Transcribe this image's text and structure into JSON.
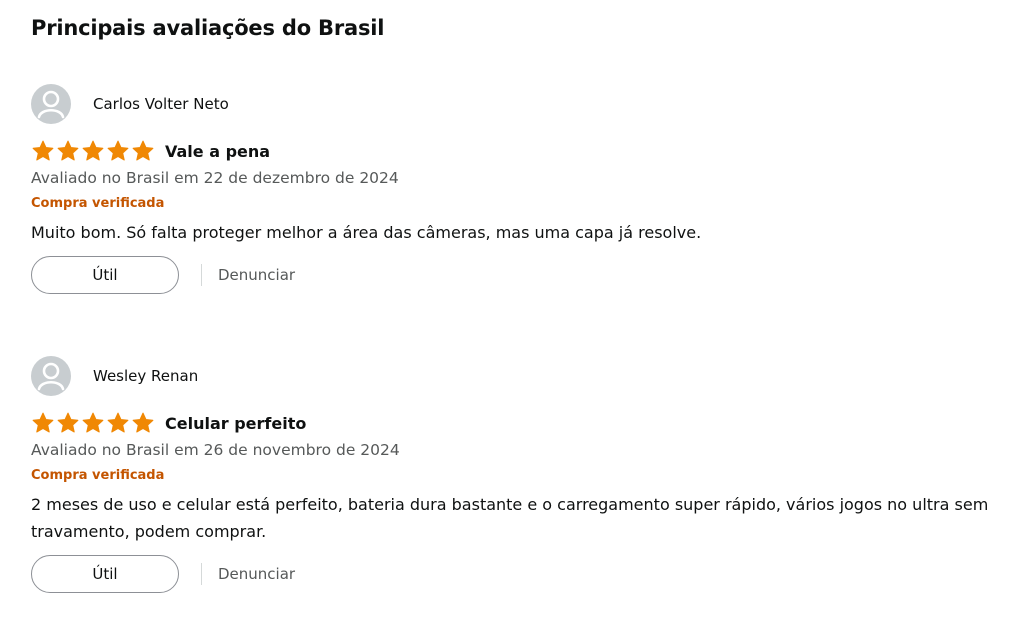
{
  "section": {
    "title": "Principais avaliações do Brasil"
  },
  "colors": {
    "star": "#f08804",
    "verified": "#c45500",
    "muted": "#565959",
    "text": "#0f1111"
  },
  "reviews": [
    {
      "author": "Carlos Volter Neto",
      "rating": 5,
      "rating_max": 5,
      "title": "Vale a pena",
      "date_text": "Avaliado no Brasil em 22 de dezembro de 2024",
      "verified_label": "Compra verificada",
      "body": "Muito bom. Só falta proteger melhor a área das câmeras, mas uma capa já resolve.",
      "helpful_label": "Útil",
      "report_label": "Denunciar"
    },
    {
      "author": "Wesley Renan",
      "rating": 5,
      "rating_max": 5,
      "title": "Celular perfeito",
      "date_text": "Avaliado no Brasil em 26 de novembro de 2024",
      "verified_label": "Compra verificada",
      "body": "2 meses de uso e celular está perfeito, bateria dura bastante e o carregamento super rápido, vários jogos no ultra sem travamento, podem comprar.",
      "helpful_label": "Útil",
      "report_label": "Denunciar"
    }
  ]
}
